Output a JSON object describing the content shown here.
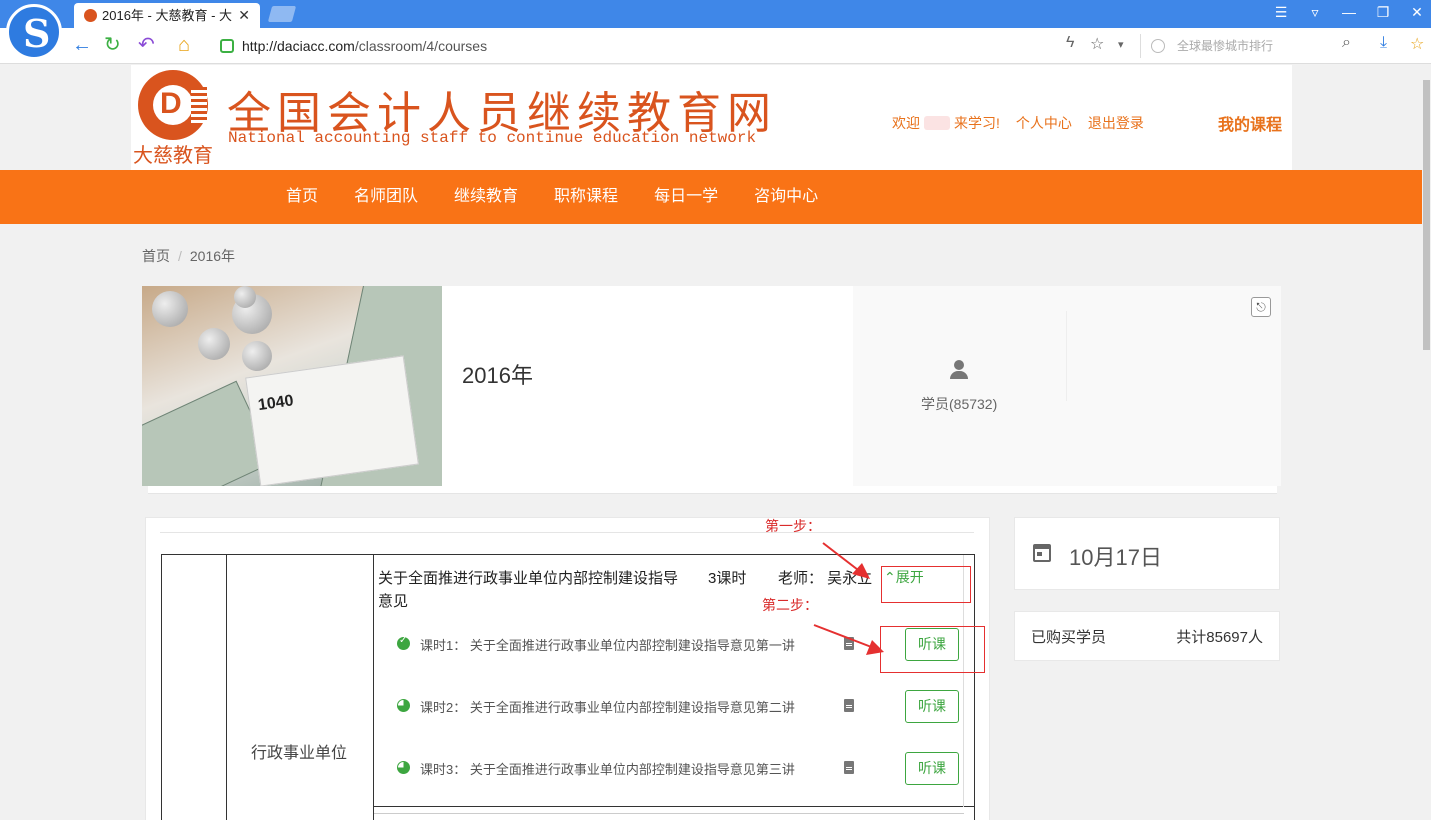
{
  "browser": {
    "tab_title": "2016年 - 大慈教育 - 大",
    "tab_close": "✕",
    "url_host": "http://daciacc.com",
    "url_path": "/classroom/4/courses",
    "search_placeholder": "全球最惨城市排行",
    "icons": [
      "back-icon",
      "refresh-icon",
      "undo-icon",
      "home-icon",
      "shield-icon",
      "lightning-icon",
      "star-icon",
      "search-icon",
      "download-icon",
      "favorites-icon"
    ]
  },
  "site": {
    "brand_small": "大慈教育",
    "brand_cn": "全国会计人员继续教育网",
    "brand_en": "National accounting staff to continue education network",
    "welcome_prefix": "欢迎",
    "welcome_suffix": "来学习!",
    "personal_center": "个人中心",
    "logout": "退出登录",
    "my_courses": "我的课程",
    "brand_color": "#f97316"
  },
  "nav": {
    "items": [
      "首页",
      "名师团队",
      "继续教育",
      "职称课程",
      "每日一学",
      "咨询中心"
    ]
  },
  "breadcrumb": {
    "home": "首页",
    "sep": "/",
    "current": "2016年"
  },
  "course": {
    "title": "2016年",
    "students": "学员(85732)",
    "cover_form_label": "1040"
  },
  "chapter": {
    "category": "行政事业单位",
    "title": "关于全面推进行政事业单位内部控制建设指导意见",
    "hours": "3课时",
    "teacher": "老师：  吴永立",
    "expand": "⌃展开",
    "lessons": [
      {
        "label": "课时1：  关于全面推进行政事业单位内部控制建设指导意见第一讲",
        "status": "done",
        "button": "听课"
      },
      {
        "label": "课时2：  关于全面推进行政事业单位内部控制建设指导意见第二讲",
        "status": "in-progress",
        "button": "听课"
      },
      {
        "label": "课时3：  关于全面推进行政事业单位内部控制建设指导意见第三讲",
        "status": "in-progress",
        "button": "听课"
      }
    ]
  },
  "sidebar": {
    "date": "10月17日",
    "buyers_label": "已购买学员",
    "buyers_total": "共计85697人"
  },
  "annotations": {
    "step1": "第一步：",
    "step2": "第二步：",
    "color": "#e53030"
  }
}
